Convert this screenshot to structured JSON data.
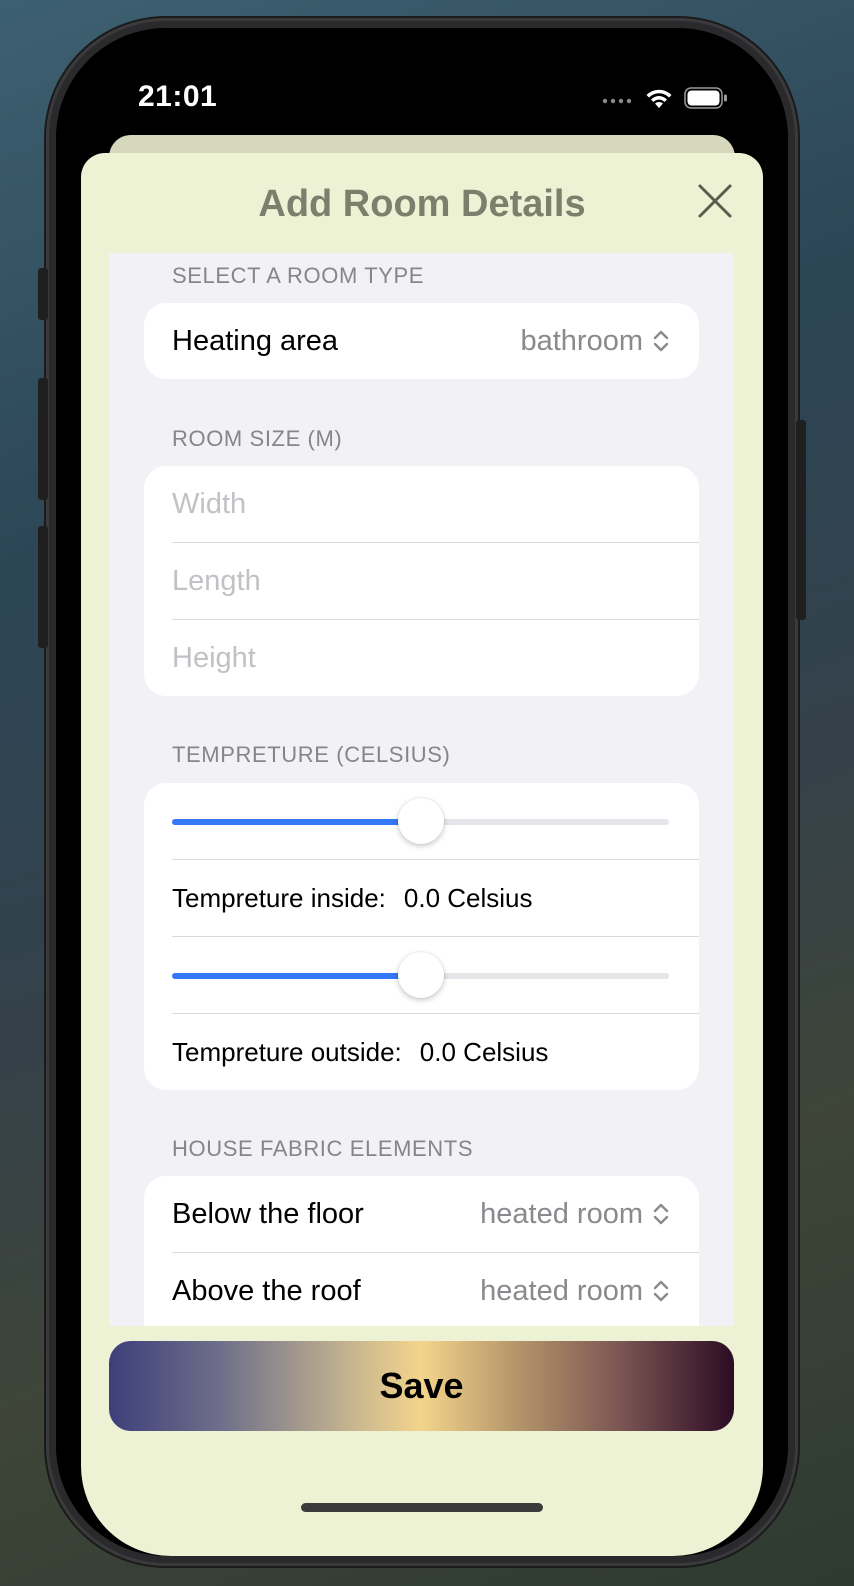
{
  "status_bar": {
    "time": "21:01"
  },
  "sheet": {
    "title": "Add Room Details",
    "close_icon": "close-icon"
  },
  "room_type": {
    "section_label": "SELECT A ROOM TYPE",
    "label": "Heating area",
    "value": "bathroom"
  },
  "room_size": {
    "section_label": "ROOM SIZE (M)",
    "width_placeholder": "Width",
    "length_placeholder": "Length",
    "height_placeholder": "Height"
  },
  "temperature": {
    "section_label": "TEMPRETURE (CELSIUS)",
    "inside_slider_fraction": 0.5,
    "inside_label": "Tempreture inside:",
    "inside_value": "0.0 Celsius",
    "outside_slider_fraction": 0.5,
    "outside_label": "Tempreture outside:",
    "outside_value": "0.0 Celsius",
    "accent_color": "#3478f6"
  },
  "house_fabric": {
    "section_label": "HOUSE FABRIC ELEMENTS",
    "items": [
      {
        "label": "Below the floor",
        "value": "heated room"
      },
      {
        "label": "Above the roof",
        "value": "heated room"
      }
    ]
  },
  "save_button": {
    "label": "Save"
  }
}
